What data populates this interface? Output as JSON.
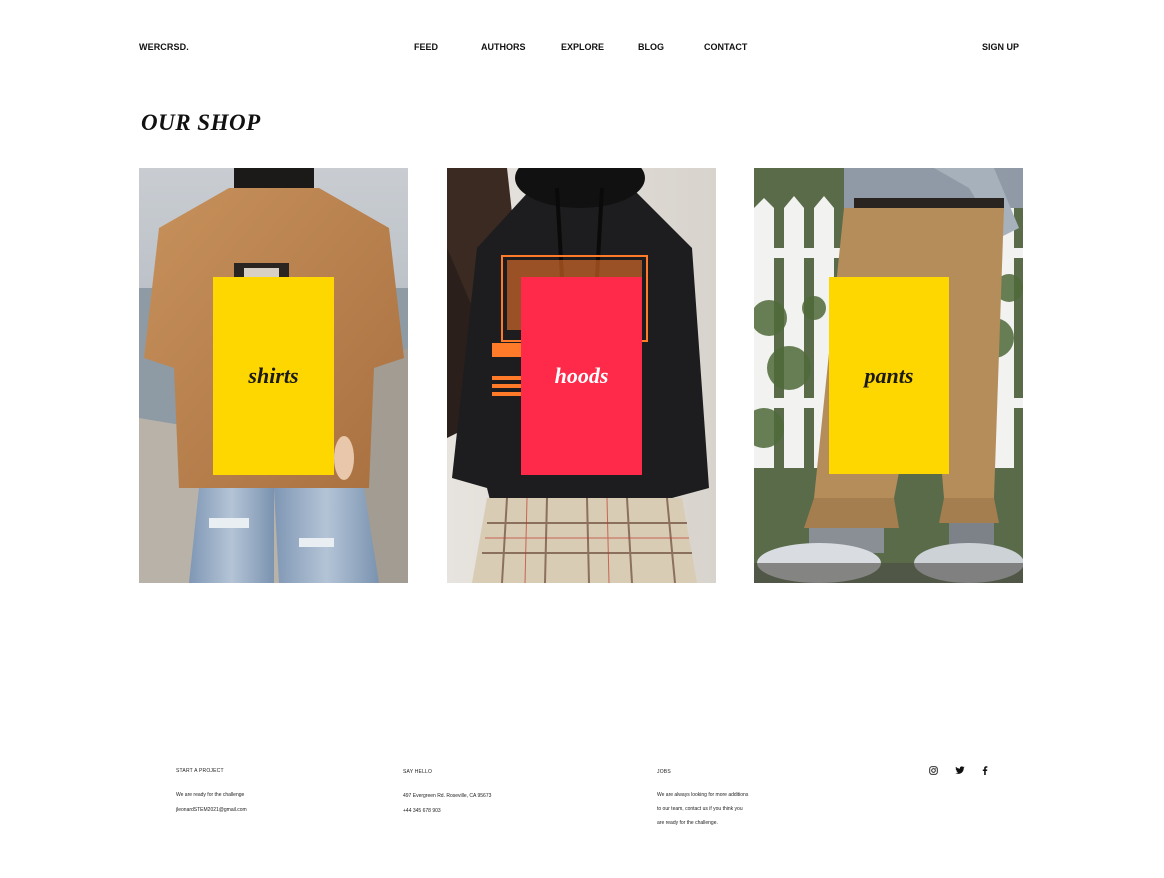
{
  "header": {
    "logo": "WERCRSD.",
    "nav": [
      "FEED",
      "AUTHORS",
      "EXPLORE",
      "BLOG",
      "CONTACT"
    ],
    "signup": "SIGN UP"
  },
  "page_title": "OUR SHOP",
  "categories": [
    {
      "label": "shirts",
      "tag_color": "#ffd700"
    },
    {
      "label": "hoods",
      "tag_color": "#ff2a4a"
    },
    {
      "label": "pants",
      "tag_color": "#ffd700"
    }
  ],
  "footer": {
    "project": {
      "heading": "START A PROJECT",
      "lines": [
        "We are ready for the challenge",
        "jleonardSTEM2021@gmail.com"
      ]
    },
    "hello": {
      "heading": "SAY HELLO",
      "lines": [
        "497 Evergreen Rd. Roseville, CA 95673",
        "+44 345 678 903"
      ]
    },
    "jobs": {
      "heading": "JOBS",
      "lines": [
        "We are always looking for more additions",
        "to our team, contact us if you think you",
        "are ready for the challenge."
      ]
    },
    "social_icons": [
      "instagram-icon",
      "twitter-icon",
      "facebook-icon"
    ]
  }
}
